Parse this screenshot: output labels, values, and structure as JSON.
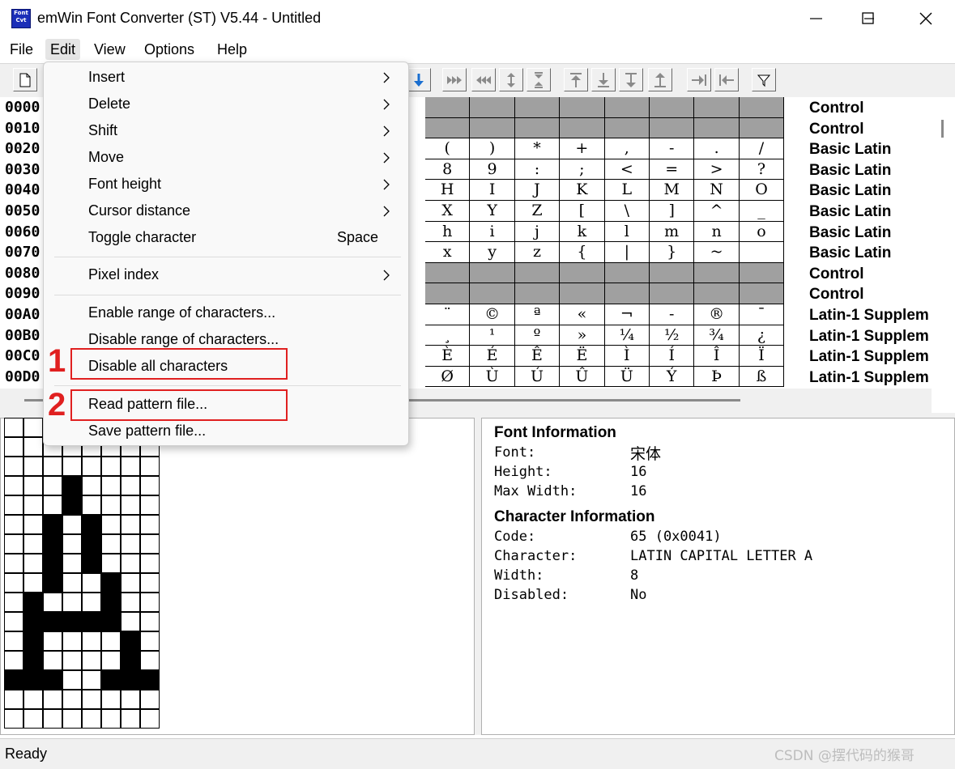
{
  "window": {
    "title": "emWin Font Converter (ST) V5.44 - Untitled",
    "icon_text": "Font Cvt",
    "controls": [
      "minimize-icon",
      "maximize-icon",
      "close-icon"
    ]
  },
  "menubar": [
    "File",
    "Edit",
    "View",
    "Options",
    "Help"
  ],
  "edit_menu": {
    "items": [
      {
        "label": "Insert",
        "submenu": true
      },
      {
        "label": "Delete",
        "submenu": true
      },
      {
        "label": "Shift",
        "submenu": true
      },
      {
        "label": "Move",
        "submenu": true
      },
      {
        "label": "Font height",
        "submenu": true
      },
      {
        "label": "Cursor distance",
        "submenu": true
      },
      {
        "label": "Toggle character",
        "shortcut": "Space"
      },
      {
        "label": "Pixel index",
        "submenu": true
      },
      {
        "label": "Enable range of characters..."
      },
      {
        "label": "Disable range of characters..."
      },
      {
        "label": "Disable all characters"
      },
      {
        "label": "Read pattern file..."
      },
      {
        "label": "Save pattern file..."
      }
    ]
  },
  "annotations": [
    {
      "number": "1",
      "target": "Disable all characters"
    },
    {
      "number": "2",
      "target": "Read pattern file..."
    }
  ],
  "char_table": {
    "codes": [
      "0000",
      "0010",
      "0020",
      "0030",
      "0040",
      "0050",
      "0060",
      "0070",
      "0080",
      "0090",
      "00A0",
      "00B0",
      "00C0",
      "00D0"
    ],
    "blocks": [
      "Control",
      "Control",
      "Basic Latin",
      "Basic Latin",
      "Basic Latin",
      "Basic Latin",
      "Basic Latin",
      "Basic Latin",
      "Control",
      "Control",
      "Latin-1 Supplem",
      "Latin-1 Supplem",
      "Latin-1 Supplem",
      "Latin-1 Supplem"
    ],
    "visible_chars": [
      [
        "",
        "",
        "",
        "",
        "",
        "",
        "",
        ""
      ],
      [
        "",
        "",
        "",
        "",
        "",
        "",
        "",
        ""
      ],
      [
        "(",
        ")",
        "*",
        "+",
        ",",
        "-",
        ".",
        "/"
      ],
      [
        "8",
        "9",
        ":",
        ";",
        "<",
        "=",
        ">",
        "?"
      ],
      [
        "H",
        "I",
        "J",
        "K",
        "L",
        "M",
        "N",
        "O"
      ],
      [
        "X",
        "Y",
        "Z",
        "[",
        "\\",
        "]",
        "^",
        "_"
      ],
      [
        "h",
        "i",
        "j",
        "k",
        "l",
        "m",
        "n",
        "o"
      ],
      [
        "x",
        "y",
        "z",
        "{",
        "|",
        "}",
        "~",
        ""
      ],
      [
        "",
        "",
        "",
        "",
        "",
        "",
        "",
        ""
      ],
      [
        "",
        "",
        "",
        "",
        "",
        "",
        "",
        ""
      ],
      [
        "¨",
        "©",
        "ª",
        "«",
        "¬",
        "-",
        "®",
        "¯"
      ],
      [
        "¸",
        "¹",
        "º",
        "»",
        "¼",
        "½",
        "¾",
        "¿"
      ],
      [
        "È",
        "É",
        "Ê",
        "Ë",
        "Ì",
        "Í",
        "Î",
        "Ï"
      ],
      [
        "Ø",
        "Ù",
        "Ú",
        "Û",
        "Ü",
        "Ý",
        "Þ",
        "ß"
      ]
    ],
    "gray_rows": [
      0,
      1,
      8,
      9
    ]
  },
  "font_info": {
    "heading": "Font Information",
    "rows": [
      {
        "label": "Font:",
        "value": "宋体"
      },
      {
        "label": "Height:",
        "value": "16"
      },
      {
        "label": "Max Width:",
        "value": "16"
      }
    ]
  },
  "char_info": {
    "heading": "Character Information",
    "rows": [
      {
        "label": "Code:",
        "value": "65 (0x0041)"
      },
      {
        "label": "Character:",
        "value": "LATIN CAPITAL LETTER A"
      },
      {
        "label": "Width:",
        "value": "8"
      },
      {
        "label": "Disabled:",
        "value": "No"
      }
    ]
  },
  "pixel_grid": {
    "cols": 8,
    "rows": 16,
    "bitmap": [
      "00000000",
      "00000000",
      "00000000",
      "00010000",
      "00010000",
      "00101000",
      "00101000",
      "00101000",
      "00100100",
      "01000100",
      "01111100",
      "01000010",
      "01000010",
      "11100111",
      "00000000",
      "00000000"
    ]
  },
  "status": {
    "text": "Ready"
  },
  "watermark": "CSDN @摆代码的猴哥"
}
